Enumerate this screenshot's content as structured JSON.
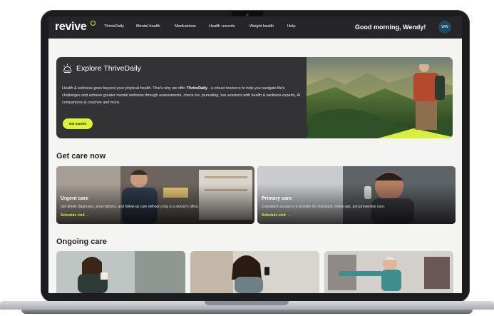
{
  "nav": {
    "logo": "revive",
    "links": [
      "ThriveDaily",
      "Mental health",
      "Medications",
      "Health records",
      "Weight health",
      "Help"
    ],
    "greeting": "Good morning, Wendy!",
    "avatar_initials": "WW"
  },
  "hero": {
    "title": "Explore ThriveDaily",
    "body_prefix": "Health & wellness goes beyond your physical health. That's why we offer ",
    "body_strong": "ThriveDaily",
    "body_suffix": " - a robust resource to help you navigate life's challenges and achieve greater mental wellness through assessments, check ins, journaling, live sessions with health & wellness experts, AI companions & coaches and more.",
    "cta": "Get started"
  },
  "get_care": {
    "title": "Get care now",
    "cards": [
      {
        "title": "Urgent care",
        "desc": "Get timely diagnoses, prescriptions, and follow-up care without a trip to a doctor's office.",
        "link": "Schedule visit"
      },
      {
        "title": "Primary care",
        "desc": "Consistent access to a provider for checkups, follow-ups, and preventive care.",
        "link": "Schedule visit"
      }
    ]
  },
  "ongoing_care": {
    "title": "Ongoing care"
  },
  "colors": {
    "accent": "#dcf23b",
    "nav_bg": "#262629",
    "hero_bg": "#333336",
    "avatar_bg": "#1d4b63"
  }
}
